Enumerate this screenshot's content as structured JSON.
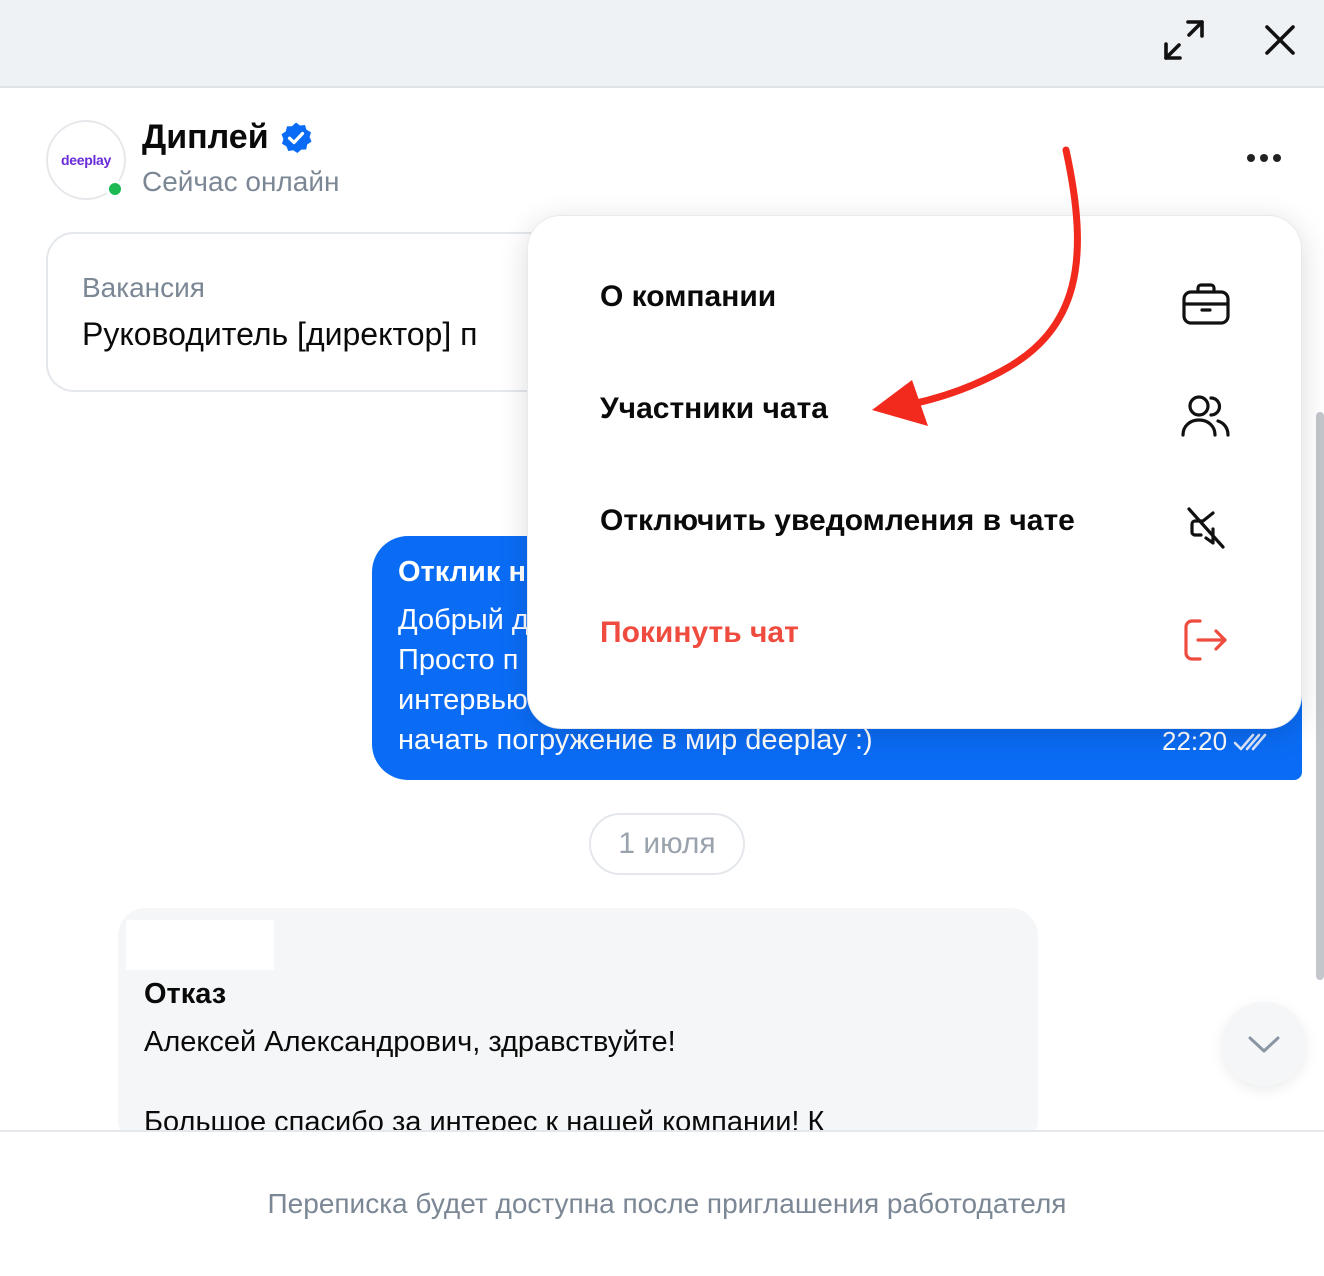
{
  "window": {
    "expand_icon": "expand-arrows-icon",
    "close_icon": "close-icon"
  },
  "header": {
    "avatar_logo": "deeplay",
    "company_name": "Диплей",
    "verified_icon": "verified-badge-icon",
    "status": "Сейчас онлайн",
    "more_icon": "more-dots-icon"
  },
  "vacancy": {
    "label": "Вакансия",
    "title": "Руководитель [директор] п"
  },
  "outgoing_message": {
    "title": "Отклик н",
    "lines": [
      "Добрый д",
      "Просто п",
      "интервью",
      "начать погружение в мир deeplay :)"
    ],
    "time": "22:20",
    "read_icon": "double-check-icon"
  },
  "date_separator": "1 июля",
  "incoming_message": {
    "title": "Отказ",
    "line1": "Алексей Александрович, здравствуйте!",
    "line2": "Большое спасибо за интерес к нашей компании! К"
  },
  "scroll_down_icon": "chevron-down-icon",
  "footer": {
    "notice": "Переписка будет доступна после приглашения работодателя"
  },
  "menu": {
    "items": [
      {
        "label": "О компании",
        "icon": "briefcase-icon"
      },
      {
        "label": "Участники чата",
        "icon": "users-icon"
      },
      {
        "label": "Отключить уведомления в чате",
        "icon": "mute-icon"
      },
      {
        "label": "Покинуть чат",
        "icon": "logout-icon"
      }
    ]
  },
  "colors": {
    "accent_blue": "#0a6cf5",
    "danger_red": "#ef4b3f",
    "online_green": "#1db954",
    "annotation_arrow": "#f2291d"
  }
}
